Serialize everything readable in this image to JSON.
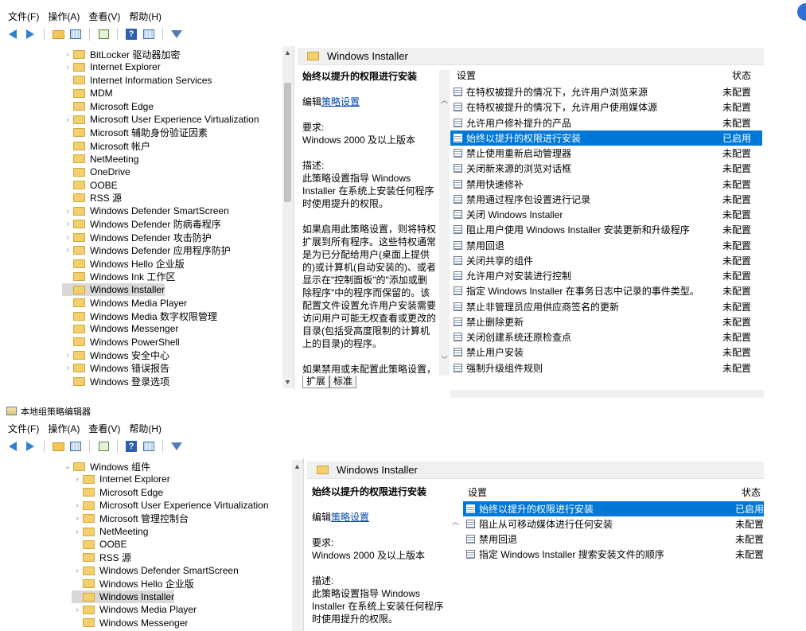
{
  "window1": {
    "menu": [
      "文件(F)",
      "操作(A)",
      "查看(V)",
      "帮助(H)"
    ],
    "tree_items": [
      {
        "label": "BitLocker 驱动器加密",
        "expandable": true
      },
      {
        "label": "Internet Explorer",
        "expandable": true
      },
      {
        "label": "Internet Information Services",
        "expandable": false
      },
      {
        "label": "MDM",
        "expandable": false
      },
      {
        "label": "Microsoft Edge",
        "expandable": false
      },
      {
        "label": "Microsoft User Experience Virtualization",
        "expandable": true
      },
      {
        "label": "Microsoft 辅助身份验证因素",
        "expandable": false
      },
      {
        "label": "Microsoft 帐户",
        "expandable": false
      },
      {
        "label": "NetMeeting",
        "expandable": false
      },
      {
        "label": "OneDrive",
        "expandable": false
      },
      {
        "label": "OOBE",
        "expandable": false
      },
      {
        "label": "RSS 源",
        "expandable": false
      },
      {
        "label": "Windows Defender SmartScreen",
        "expandable": true
      },
      {
        "label": "Windows Defender 防病毒程序",
        "expandable": true
      },
      {
        "label": "Windows Defender 攻击防护",
        "expandable": true
      },
      {
        "label": "Windows Defender 应用程序防护",
        "expandable": true
      },
      {
        "label": "Windows Hello 企业版",
        "expandable": false
      },
      {
        "label": "Windows Ink 工作区",
        "expandable": false
      },
      {
        "label": "Windows Installer",
        "expandable": false,
        "selected": true
      },
      {
        "label": "Windows Media Player",
        "expandable": false
      },
      {
        "label": "Windows Media 数字权限管理",
        "expandable": false
      },
      {
        "label": "Windows Messenger",
        "expandable": false
      },
      {
        "label": "Windows PowerShell",
        "expandable": false
      },
      {
        "label": "Windows 安全中心",
        "expandable": true
      },
      {
        "label": "Windows 错误报告",
        "expandable": true
      },
      {
        "label": "Windows 登录选项",
        "expandable": false
      }
    ],
    "header_title": "Windows Installer",
    "desc_title": "始终以提升的权限进行安装",
    "desc_edit_prefix": "编辑",
    "desc_edit_link": "策略设置",
    "desc_req_label": "要求:",
    "desc_req_value": "Windows 2000 及以上版本",
    "desc_label": "描述:",
    "desc_text1": "此策略设置指导 Windows Installer 在系统上安装任何程序时使用提升的权限。",
    "desc_text2": "如果启用此策略设置，则将特权扩展到所有程序。这些特权通常是为已分配给用户(桌面上提供的)或计算机(自动安装的)、或者显示在\"控制面板\"的\"添加或删除程序\"中的程序而保留的。该配置文件设置允许用户安装需要访问用户可能无权查看或更改的目录(包括受高度限制的计算机上的目录)的程序。",
    "desc_text3": "如果禁用或未配置此策略设置，当安装的程序不是系统管理员分发或",
    "col_setting": "设置",
    "col_state": "状态",
    "rows": [
      {
        "name": "在特权被提升的情况下，允许用户浏览来源",
        "state": "未配置"
      },
      {
        "name": "在特权被提升的情况下，允许用户使用媒体源",
        "state": "未配置"
      },
      {
        "name": "允许用户修补提升的产品",
        "state": "未配置"
      },
      {
        "name": "始终以提升的权限进行安装",
        "state": "已启用",
        "selected": true
      },
      {
        "name": "禁止使用重新启动管理器",
        "state": "未配置"
      },
      {
        "name": "关闭新来源的浏览对话框",
        "state": "未配置"
      },
      {
        "name": "禁用快速修补",
        "state": "未配置"
      },
      {
        "name": "禁用通过程序包设置进行记录",
        "state": "未配置"
      },
      {
        "name": "关闭 Windows Installer",
        "state": "未配置"
      },
      {
        "name": "阻止用户使用 Windows Installer 安装更新和升级程序",
        "state": "未配置"
      },
      {
        "name": "禁用回退",
        "state": "未配置"
      },
      {
        "name": "关闭共享的组件",
        "state": "未配置"
      },
      {
        "name": "允许用户对安装进行控制",
        "state": "未配置"
      },
      {
        "name": "指定 Windows Installer 在事务日志中记录的事件类型。",
        "state": "未配置"
      },
      {
        "name": "禁止非管理员应用供应商签名的更新",
        "state": "未配置"
      },
      {
        "name": "禁止删除更新",
        "state": "未配置"
      },
      {
        "name": "关闭创建系统还原检查点",
        "state": "未配置"
      },
      {
        "name": "禁止用户安装",
        "state": "未配置"
      },
      {
        "name": "强制升级组件规则",
        "state": "未配置"
      }
    ],
    "tabs": [
      "扩展",
      "标准"
    ]
  },
  "window2": {
    "title": "本地组策略编辑器",
    "menu": [
      "文件(F)",
      "操作(A)",
      "查看(V)",
      "帮助(H)"
    ],
    "tree_items": [
      {
        "label": "Windows 组件",
        "expandable": true,
        "expanded": true,
        "level": 0
      },
      {
        "label": "Internet Explorer",
        "expandable": true,
        "level": 1
      },
      {
        "label": "Microsoft Edge",
        "expandable": false,
        "level": 1
      },
      {
        "label": "Microsoft User Experience Virtualization",
        "expandable": true,
        "level": 1
      },
      {
        "label": "Microsoft 管理控制台",
        "expandable": true,
        "level": 1
      },
      {
        "label": "NetMeeting",
        "expandable": true,
        "level": 1
      },
      {
        "label": "OOBE",
        "expandable": false,
        "level": 1
      },
      {
        "label": "RSS 源",
        "expandable": false,
        "level": 1
      },
      {
        "label": "Windows Defender SmartScreen",
        "expandable": true,
        "level": 1
      },
      {
        "label": "Windows Hello 企业版",
        "expandable": false,
        "level": 1
      },
      {
        "label": "Windows Installer",
        "expandable": false,
        "level": 1,
        "selected": true
      },
      {
        "label": "Windows Media Player",
        "expandable": true,
        "level": 1
      },
      {
        "label": "Windows Messenger",
        "expandable": false,
        "level": 1
      }
    ],
    "header_title": "Windows Installer",
    "desc_title": "始终以提升的权限进行安装",
    "desc_edit_prefix": "编辑",
    "desc_edit_link": "策略设置",
    "desc_req_label": "要求:",
    "desc_req_value": "Windows 2000 及以上版本",
    "desc_label": "描述:",
    "desc_text1": "此策略设置指导 Windows Installer 在系统上安装任何程序时使用提升的权限。",
    "col_setting": "设置",
    "col_state": "状态",
    "rows": [
      {
        "name": "始终以提升的权限进行安装",
        "state": "已启用",
        "selected": true
      },
      {
        "name": "阻止从可移动媒体进行任何安装",
        "state": "未配置"
      },
      {
        "name": "禁用回退",
        "state": "未配置"
      },
      {
        "name": "指定 Windows Installer 搜索安装文件的顺序",
        "state": "未配置"
      }
    ]
  },
  "colors": {
    "selection": "#0078d7",
    "tree_selection": "#d9d9d9",
    "link": "#0645ad",
    "folder": "#f3cf6d"
  }
}
